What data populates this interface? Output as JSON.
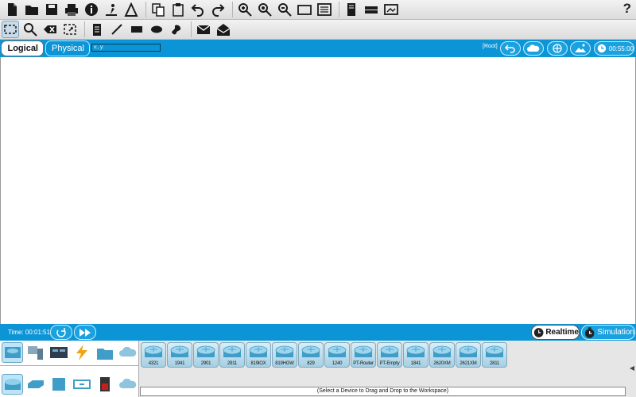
{
  "toolbar_main": {
    "icons": [
      "new-file-icon",
      "open-folder-icon",
      "save-icon",
      "print-icon",
      "info-icon",
      "activity-wizard-icon",
      "activity-wizard-2-icon",
      "copy-icon",
      "paste-icon",
      "undo-icon",
      "redo-icon",
      "zoom-in-icon",
      "zoom-reset-icon",
      "zoom-out-icon",
      "window-icon",
      "palette-icon",
      "custom-device-icon",
      "router-icon",
      "screen-icon"
    ],
    "help_label": "?"
  },
  "toolbar_tools": {
    "icons": [
      "select-icon",
      "inspect-icon",
      "delete-icon",
      "resize-icon",
      "note-icon",
      "line-icon",
      "rectangle-icon",
      "ellipse-icon",
      "freeform-icon",
      "pdu-simple-icon",
      "pdu-complex-icon"
    ]
  },
  "view_bar": {
    "logical_label": "Logical",
    "physical_label": "Physical",
    "coords_label": "x:, y:",
    "root_label": "[Root]",
    "clock_label": "00:55:00"
  },
  "time_bar": {
    "time_label": "Time: 00:01:51",
    "realtime_label": "Realtime",
    "simulation_label": "Simulation"
  },
  "device_panel": {
    "hint": "(Select a Device to Drag and Drop to the Workspace)",
    "devices": [
      "4321",
      "1941",
      "2901",
      "2911",
      "819IOX",
      "819HGW",
      "829",
      "1240",
      "PT-Router",
      "PT-Empty",
      "1841",
      "2620XM",
      "2621XM",
      "2811"
    ]
  },
  "colors": {
    "accent_blue": "#0c95d6",
    "toolbar_bg": "#e0e0e0"
  }
}
